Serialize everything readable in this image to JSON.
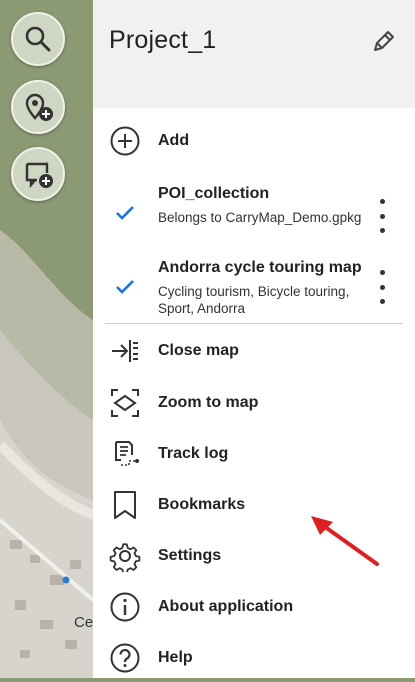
{
  "project": {
    "title": "Project_1"
  },
  "menu": {
    "add_label": "Add",
    "close_map_label": "Close map",
    "zoom_to_map_label": "Zoom to map",
    "track_log_label": "Track log",
    "bookmarks_label": "Bookmarks",
    "settings_label": "Settings",
    "about_label": "About application",
    "help_label": "Help"
  },
  "layers": [
    {
      "title": "POI_collection",
      "description": "Belongs to CarryMap_Demo.gpkg",
      "checked": true
    },
    {
      "title": "Andorra cycle touring map",
      "description": "Cycling tourism, Bicycle touring, Sport, Andorra",
      "checked": true
    }
  ],
  "map": {
    "partial_label": "Ce"
  },
  "colors": {
    "accent_check": "#1a73e8",
    "annotation_arrow": "#e02020",
    "drawer_header_bg": "#f1f1f1"
  },
  "icons": {
    "search": "search-icon",
    "add_poi": "add-poi-icon",
    "add_note": "add-note-icon",
    "edit": "pencil-icon"
  }
}
